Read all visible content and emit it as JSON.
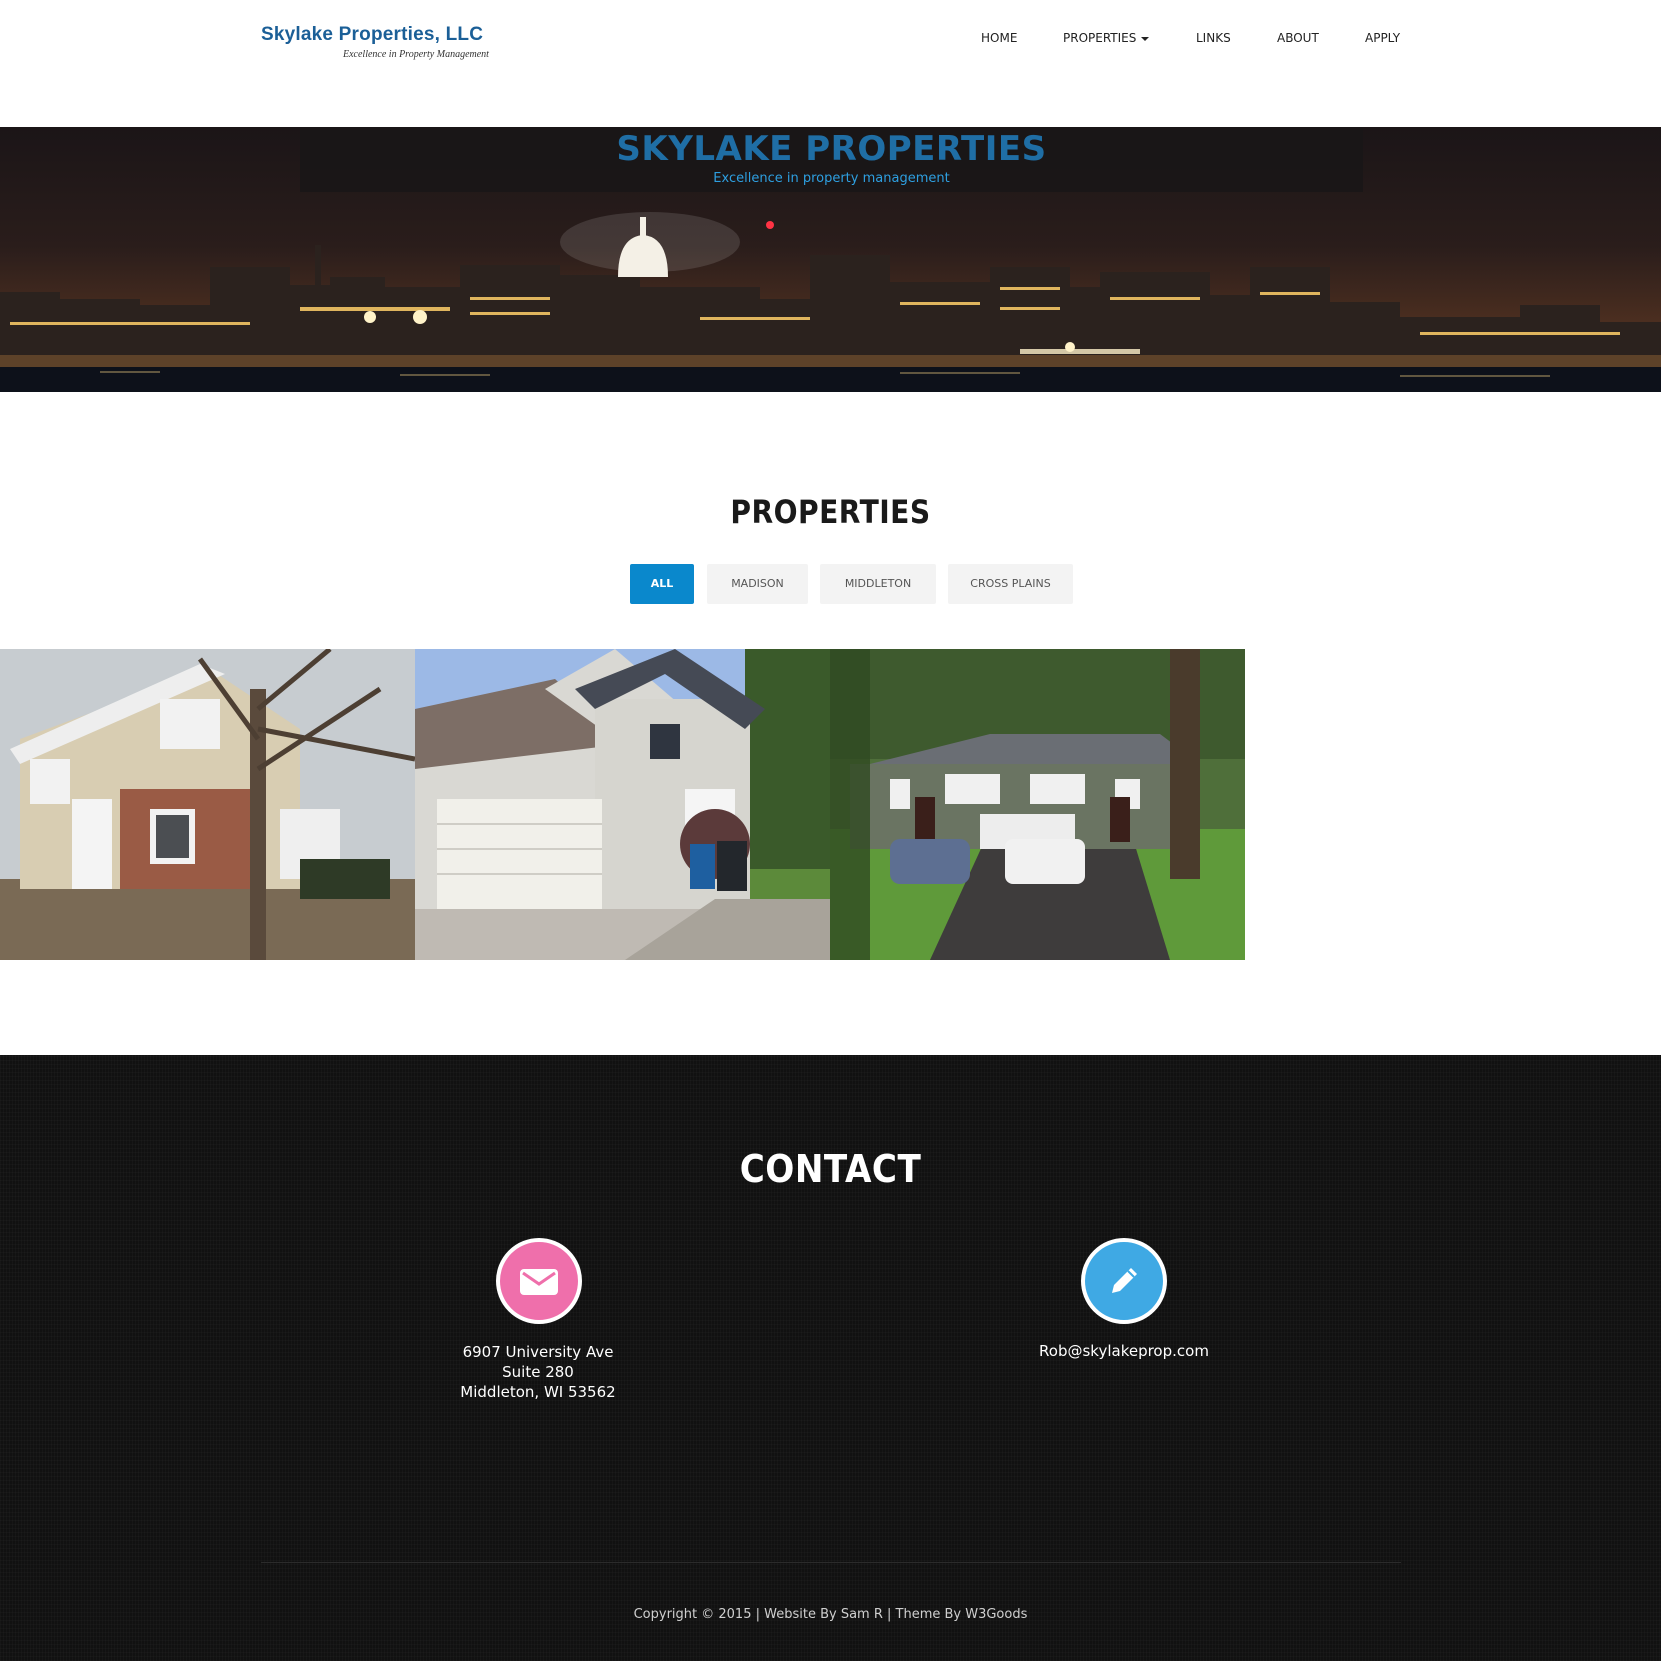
{
  "logo": {
    "title": "Skylake Properties, LLC",
    "tagline": "Excellence in Property Management"
  },
  "nav": {
    "home": "HOME",
    "properties": "PROPERTIES",
    "links": "LINKS",
    "about": "ABOUT",
    "apply": "APPLY"
  },
  "banner": {
    "title": "SKYLAKE PROPERTIES",
    "subtitle": "Excellence in property management"
  },
  "properties": {
    "title": "PROPERTIES",
    "filters": [
      "ALL",
      "MADISON",
      "MIDDLETON",
      "CROSS PLAINS"
    ],
    "active_filter": "ALL"
  },
  "contact": {
    "title": "CONTACT",
    "address": [
      "6907 University Ave",
      "Suite 280",
      "Middleton, WI 53562"
    ],
    "email": "Rob@skylakeprop.com",
    "icons": {
      "address": "envelope-icon",
      "email": "pencil-icon"
    },
    "colors": {
      "envelope": "#ef6fab",
      "pencil": "#3fa9e4"
    }
  },
  "footer": {
    "copyright": "Copyright © 2015 | Website By Sam R | Theme By W3Goods"
  },
  "colors": {
    "accent": "#0a88cc",
    "logo_blue": "#1b5f97",
    "banner_title": "#1f6ea5"
  }
}
